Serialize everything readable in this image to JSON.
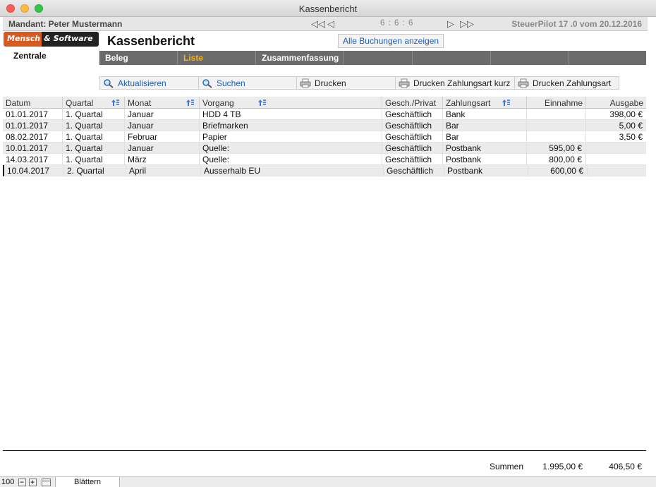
{
  "window": {
    "title": "Kassenbericht"
  },
  "mandant_bar": {
    "mandant": "Mandant: Peter Mustermann",
    "counter": "6 : 6 : 6",
    "version": "SteuerPilot 17 .0 vom 20.12.2016"
  },
  "logo": {
    "part1": "Mensch",
    "part2": "& Software"
  },
  "sidebar": {
    "zentrale": "Zentrale"
  },
  "header": {
    "title": "Kassenbericht",
    "all_button": "Alle Buchungen anzeigen"
  },
  "tabs": [
    {
      "label": "Beleg"
    },
    {
      "label": "Liste",
      "active": true
    },
    {
      "label": "Zusammenfassung"
    },
    {
      "label": ""
    },
    {
      "label": ""
    },
    {
      "label": ""
    },
    {
      "label": ""
    }
  ],
  "toolbar": {
    "refresh": "Aktualisieren",
    "search": "Suchen",
    "print": "Drucken",
    "print_short": "Drucken Zahlungsart kurz",
    "print_payment": "Drucken Zahlungsart"
  },
  "table": {
    "columns": [
      "Datum",
      "Quartal",
      "Monat",
      "Vorgang",
      "Gesch./Privat",
      "Zahlungsart",
      "Einnahme",
      "Ausgabe"
    ],
    "rows": [
      [
        "01.01.2017",
        "1. Quartal",
        "Januar",
        "HDD 4 TB",
        "Geschäftlich",
        "Bank",
        "",
        "398,00 €"
      ],
      [
        "01.01.2017",
        "1. Quartal",
        "Januar",
        "Briefmarken",
        "Geschäftlich",
        "Bar",
        "",
        "5,00 €"
      ],
      [
        "08.02.2017",
        "1. Quartal",
        "Februar",
        "Papier",
        "Geschäftlich",
        "Bar",
        "",
        "3,50 €"
      ],
      [
        "10.01.2017",
        "1. Quartal",
        "Januar",
        "Quelle:",
        "Geschäftlich",
        "Postbank",
        "595,00 €",
        ""
      ],
      [
        "14.03.2017",
        "1. Quartal",
        "März",
        "Quelle:",
        "Geschäftlich",
        "Postbank",
        "800,00 €",
        ""
      ],
      [
        "10.04.2017",
        "2. Quartal",
        "April",
        "Ausserhalb EU",
        "Geschäftlich",
        "Postbank",
        "600,00 €",
        ""
      ]
    ]
  },
  "sums": {
    "label": "Summen",
    "einnahme": "1.995,00 €",
    "ausgabe": "406,50 €"
  },
  "statusbar": {
    "zoom": "100",
    "mode": "Blättern"
  }
}
